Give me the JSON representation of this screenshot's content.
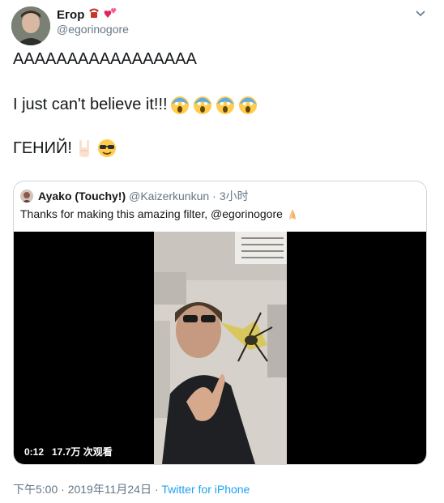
{
  "tweet": {
    "display_name": "Егор",
    "handle": "@egorinogore",
    "line1": "AAAAAAAAAAAAAAAAA",
    "line2": "I just can't believe it!!!",
    "line3": "ГЕНИЙ!",
    "name_icons": [
      "telephone-icon",
      "two-hearts-icon"
    ],
    "line2_emojis": [
      "screaming-face-icon",
      "screaming-face-icon",
      "screaming-face-icon",
      "screaming-face-icon"
    ],
    "line3_emojis": [
      "sign-of-horns-icon",
      "sunglasses-face-icon"
    ]
  },
  "quoted": {
    "display_name": "Ayako (Touchy!)",
    "handle": "@Kaizerkunkun",
    "separator": "·",
    "time": "3小时",
    "text": "Thanks for making this amazing filter, @egorinogore",
    "text_emoji": "folded-hands-icon",
    "video": {
      "duration": "0:12",
      "views": "17.7万 次观看"
    }
  },
  "meta": {
    "time": "下午5:00",
    "separator1": " · ",
    "date": "2019年11月24日",
    "separator2": " · ",
    "source": "Twitter for iPhone"
  },
  "colors": {
    "text": "#14171a",
    "secondary": "#657786",
    "link": "#1da1f2",
    "border": "#ccd6dd"
  }
}
